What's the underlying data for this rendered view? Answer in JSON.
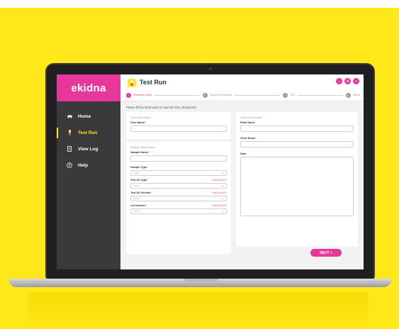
{
  "app": {
    "logo": "ekidna",
    "title": "Test Run"
  },
  "sidebar": {
    "items": [
      {
        "label": "Home",
        "icon": "car-icon"
      },
      {
        "label": "Test Run",
        "icon": "tube-icon",
        "active": true
      },
      {
        "label": "View Log",
        "icon": "document-icon"
      },
      {
        "label": "Help",
        "icon": "help-icon"
      }
    ]
  },
  "steps": [
    {
      "num": "1",
      "label": "Parameter Input",
      "active": true
    },
    {
      "num": "2",
      "label": "Sample Preparation"
    },
    {
      "num": "3",
      "label": "Test"
    },
    {
      "num": "4",
      "label": "Result"
    }
  ],
  "instruction": "Please fill the information to start the test. (Required*)",
  "your_info": {
    "title": "Your Information",
    "user_name_label": "User Name",
    "req": "*"
  },
  "sample_info": {
    "title": "Sample Information",
    "sample_name_label": "Sample Name",
    "sample_type_label": "Sample Type",
    "test_kit_type_label": "Test Kit Type",
    "test_kit_version_label": "Test Kit Version",
    "lot_number_label": "Lot Number",
    "select_placeholder": "Select",
    "how_to_find": "How to find it?",
    "req": "*"
  },
  "other_info": {
    "title": "Other Information",
    "plant_name_label": "Plant Name",
    "grow_room_label": "Grow Room",
    "note_label": "Note"
  },
  "next_button": "NEXT »",
  "colors": {
    "brand": "#e8379a",
    "background": "#ffe81a",
    "sidebar": "#3a3a3c"
  }
}
